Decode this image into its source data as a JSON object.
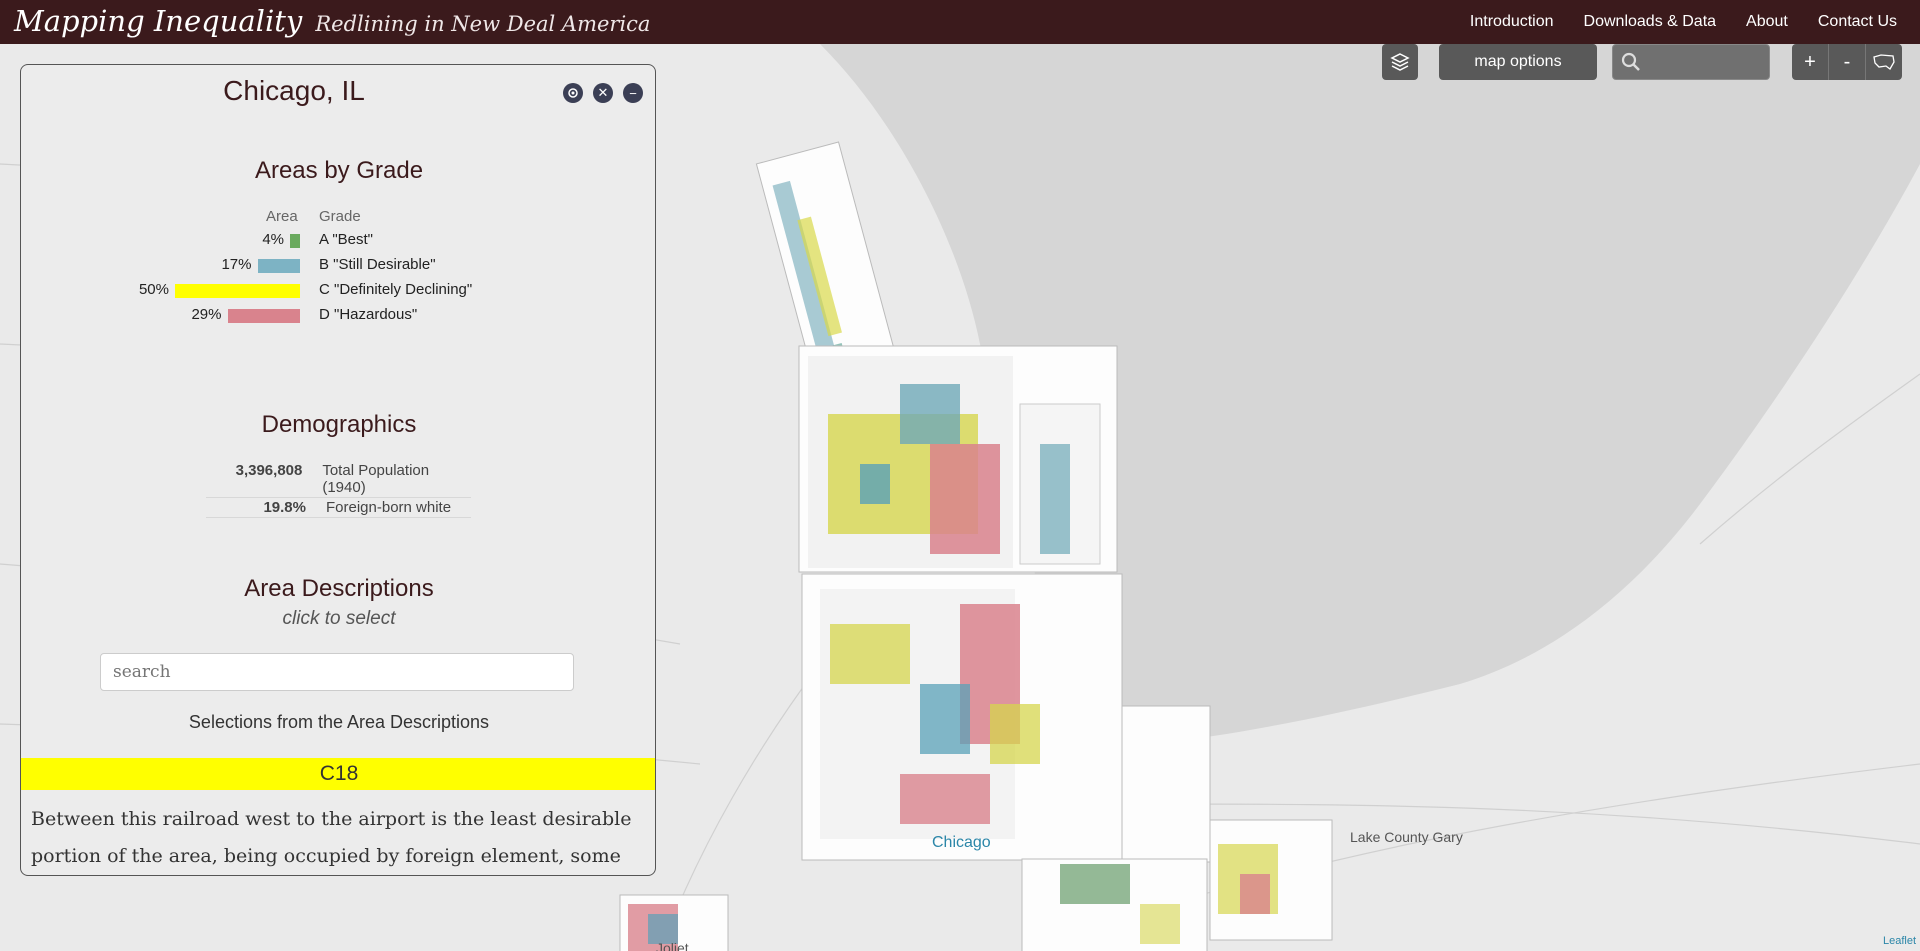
{
  "header": {
    "title": "Mapping Inequality",
    "subtitle": "Redlining in New Deal America",
    "nav": [
      "Introduction",
      "Downloads & Data",
      "About",
      "Contact Us"
    ]
  },
  "map_controls": {
    "options_label": "map options",
    "zoom_in": "+",
    "zoom_out": "-"
  },
  "map_labels": {
    "chicago": "Chicago",
    "lake_county_gary": "Lake County Gary",
    "joliet": "Joliet",
    "attribution": "Leaflet"
  },
  "panel": {
    "city": "Chicago, IL",
    "grades_title": "Areas by Grade",
    "grade_col_area": "Area",
    "grade_col_grade": "Grade",
    "grades": [
      {
        "pct": "4%",
        "value": 4,
        "label": "A \"Best\"",
        "color": "#6aaa5e"
      },
      {
        "pct": "17%",
        "value": 17,
        "label": "B \"Still Desirable\"",
        "color": "#7db3c4"
      },
      {
        "pct": "50%",
        "value": 50,
        "label": "C \"Definitely Declining\"",
        "color": "#ffff00"
      },
      {
        "pct": "29%",
        "value": 29,
        "label": "D \"Hazardous\"",
        "color": "#d9838d"
      }
    ],
    "demographics_title": "Demographics",
    "demographics": [
      {
        "value": "3,396,808",
        "label": "Total Population (1940)"
      },
      {
        "value": "19.8%",
        "label": "Foreign-born white"
      }
    ],
    "area_desc_title": "Area Descriptions",
    "area_desc_sub": "click to select",
    "search_placeholder": "search",
    "selections_heading": "Selections from the Area Descriptions",
    "selected_area": "C18",
    "selected_area_color": "#ffff00",
    "description": "Between this railroad west to the airport is the least desirable portion of the area, being occupied by foreign element, some"
  }
}
